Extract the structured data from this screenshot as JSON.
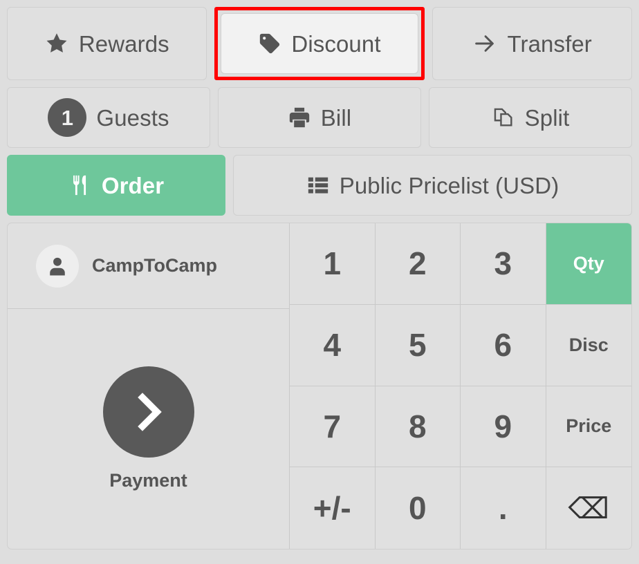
{
  "theme": {
    "background": "#dedede",
    "button_bg": "#e0e0e0",
    "button_bg_highlight": "#f2f2f2",
    "accent_green": "#6ec79b",
    "text_gray": "#555555",
    "dark_gray": "#595959",
    "annotation_red": "#ff0000"
  },
  "action_rows": {
    "row1": [
      {
        "name": "rewards",
        "label": "Rewards",
        "icon": "star-icon",
        "state": "normal"
      },
      {
        "name": "discount",
        "label": "Discount",
        "icon": "tag-icon",
        "state": "highlighted"
      },
      {
        "name": "transfer",
        "label": "Transfer",
        "icon": "arrow-right-icon",
        "state": "normal"
      }
    ],
    "row2": [
      {
        "name": "guests",
        "label": "Guests",
        "icon": "guest-count-badge",
        "badge": "1",
        "state": "normal"
      },
      {
        "name": "bill",
        "label": "Bill",
        "icon": "printer-icon",
        "state": "normal"
      },
      {
        "name": "split",
        "label": "Split",
        "icon": "split-pages-icon",
        "state": "normal"
      }
    ],
    "row3": [
      {
        "name": "order",
        "label": "Order",
        "icon": "cutlery-icon",
        "state": "active"
      },
      {
        "name": "pricelist",
        "label": "Public Pricelist (USD)",
        "icon": "list-icon",
        "state": "normal"
      }
    ]
  },
  "customer": {
    "name": "CampToCamp",
    "avatar_icon": "person-icon"
  },
  "payment": {
    "label": "Payment",
    "icon": "chevron-right-icon"
  },
  "numpad": {
    "keys": [
      {
        "label": "1",
        "name": "numpad-key-1",
        "kind": "digit",
        "state": "normal"
      },
      {
        "label": "2",
        "name": "numpad-key-2",
        "kind": "digit",
        "state": "normal"
      },
      {
        "label": "3",
        "name": "numpad-key-3",
        "kind": "digit",
        "state": "normal"
      },
      {
        "label": "Qty",
        "name": "numpad-mode-qty",
        "kind": "mode",
        "state": "active"
      },
      {
        "label": "4",
        "name": "numpad-key-4",
        "kind": "digit",
        "state": "normal"
      },
      {
        "label": "5",
        "name": "numpad-key-5",
        "kind": "digit",
        "state": "normal"
      },
      {
        "label": "6",
        "name": "numpad-key-6",
        "kind": "digit",
        "state": "normal"
      },
      {
        "label": "Disc",
        "name": "numpad-mode-disc",
        "kind": "mode",
        "state": "normal"
      },
      {
        "label": "7",
        "name": "numpad-key-7",
        "kind": "digit",
        "state": "normal"
      },
      {
        "label": "8",
        "name": "numpad-key-8",
        "kind": "digit",
        "state": "normal"
      },
      {
        "label": "9",
        "name": "numpad-key-9",
        "kind": "digit",
        "state": "normal"
      },
      {
        "label": "Price",
        "name": "numpad-mode-price",
        "kind": "mode",
        "state": "normal"
      },
      {
        "label": "+/-",
        "name": "numpad-key-sign",
        "kind": "digit",
        "state": "normal"
      },
      {
        "label": "0",
        "name": "numpad-key-0",
        "kind": "digit",
        "state": "normal"
      },
      {
        "label": ".",
        "name": "numpad-key-decimal",
        "kind": "digit",
        "state": "normal"
      },
      {
        "label": "⌫",
        "name": "numpad-backspace",
        "kind": "backspace",
        "state": "normal"
      }
    ]
  }
}
